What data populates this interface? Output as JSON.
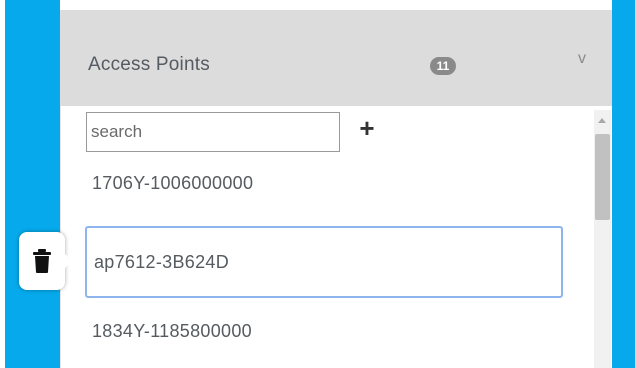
{
  "panel": {
    "title": "Access Points",
    "count": "11",
    "collapse_glyph": "v"
  },
  "search": {
    "placeholder": "search",
    "value": ""
  },
  "add_button_label": "+",
  "access_points": [
    {
      "name": "1706Y-1006000000",
      "selected": false
    },
    {
      "name": "ap7612-3B624D",
      "selected": true
    },
    {
      "name": "1834Y-1185800000",
      "selected": false
    }
  ],
  "icons": {
    "delete": "trash-icon",
    "add": "plus-icon",
    "collapse": "chevron-down-icon"
  },
  "colors": {
    "accent_blue": "#06aaec",
    "header_gray": "#dcdcdc",
    "selection_border": "#8fb6ec",
    "badge_gray": "#8a8a8a"
  }
}
